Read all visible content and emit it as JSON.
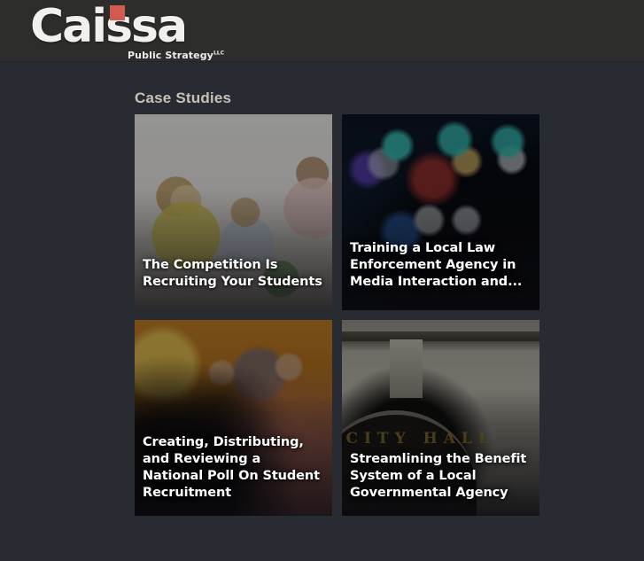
{
  "theme": {
    "header_bg": "#2d2d2c",
    "body_bg": "#292b33",
    "accent_red": "#cf5b51",
    "heading_color": "#c6c2b8",
    "card_title_color": "#ffffff"
  },
  "header": {
    "logo": {
      "wordmark": "Caissa",
      "subtitle": "Public Strategy",
      "subtitle_suffix": "LLC",
      "dot_icon": "red-square-accent-icon"
    }
  },
  "main": {
    "section_heading": "Case Studies",
    "cards": [
      {
        "title": "The Competition Is Recruiting Your Students",
        "image_name": "students-robotics-classroom-photo"
      },
      {
        "title": "Training a Local Law Enforcement Agency in Media Interaction and...",
        "image_name": "police-lights-bokeh-photo"
      },
      {
        "title": "Creating, Distributing, and Reviewing a National Poll On Student Recruitment",
        "image_name": "audience-raised-hands-photo"
      },
      {
        "title": "Streamlining the Benefit System of a Local Governmental Agency",
        "image_name": "city-hall-archway-photo",
        "image_text": "CITY HALL"
      }
    ]
  }
}
